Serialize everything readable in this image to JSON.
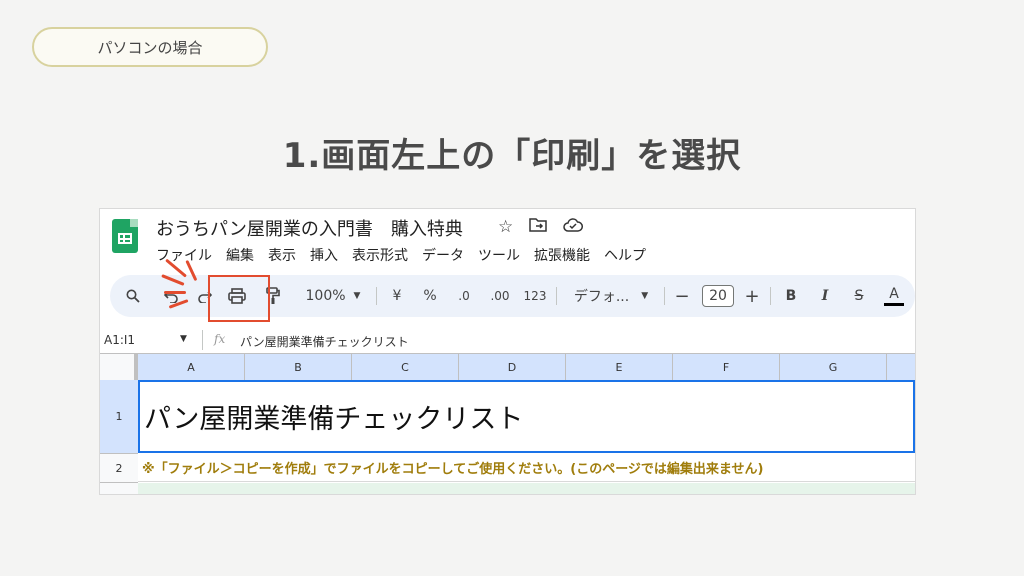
{
  "badge": "パソコンの場合",
  "heading": "1.画面左上の「印刷」を選択",
  "sheet": {
    "doc_title": "おうちパン屋開業の入門書　購入特典",
    "title_icons": [
      "star-icon",
      "folder-move-icon",
      "cloud-icon"
    ],
    "menu": [
      "ファイル",
      "編集",
      "表示",
      "挿入",
      "表示形式",
      "データ",
      "ツール",
      "拡張機能",
      "ヘルプ"
    ],
    "toolbar": {
      "zoom": "100%",
      "currency": "¥",
      "percent": "%",
      "decimal_decrease": ".0",
      "decimal_increase": ".00",
      "number_format": "123",
      "font": "デフォ...",
      "font_size": "20",
      "minus": "−",
      "plus": "+",
      "bold": "B",
      "italic": "I",
      "strike": "S",
      "text_color": "A"
    },
    "cell_ref": "A1:I1",
    "fx": "fx",
    "formula_value": "パン屋開業準備チェックリスト",
    "columns": [
      "A",
      "B",
      "C",
      "D",
      "E",
      "F",
      "G"
    ],
    "rows": [
      {
        "num": "1",
        "text": "パン屋開業準備チェックリスト"
      },
      {
        "num": "2",
        "text": "※「ファイル＞コピーを作成」でファイルをコピーしてご使用ください。(このページでは編集出来ません)"
      }
    ]
  },
  "colors": {
    "accent_highlight": "#e24c2f",
    "sheets_green": "#1fa463",
    "selection_blue": "#1a73e8"
  }
}
